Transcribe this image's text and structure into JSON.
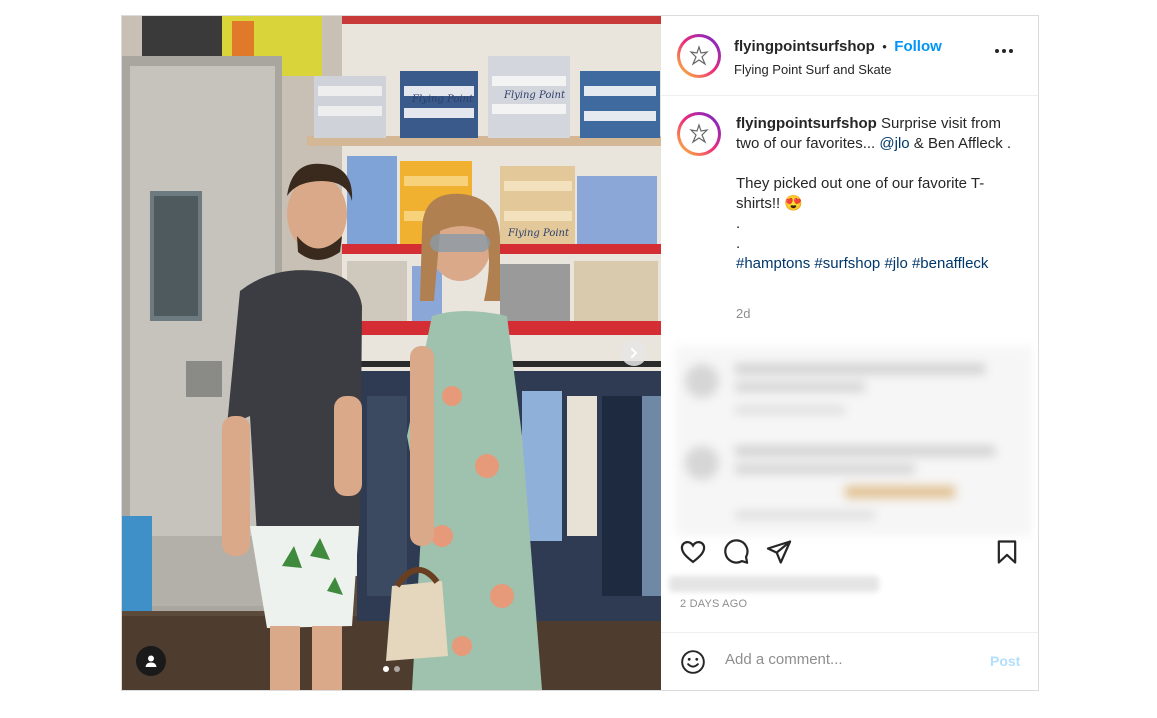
{
  "account": {
    "username": "flyingpointsurfshop",
    "separator": "•",
    "follow_label": "Follow",
    "subtitle": "Flying Point Surf and Skate"
  },
  "caption": {
    "username": "flyingpointsurfshop",
    "text_part1": " Surprise visit from two of our favorites... ",
    "mention": "@jlo",
    "text_part2": " & Ben Affleck .",
    "line2": "They picked out one of our favorite T-shirts!! ",
    "emoji": "😍",
    "dot1": ".",
    "dot2": ".",
    "hashtags": [
      "#hamptons",
      "#surfshop",
      "#jlo",
      "#benaffleck"
    ],
    "time": "2d"
  },
  "media": {
    "photo_count": 2,
    "current_photo": 1,
    "photo_text_lines": [
      "Flying Point",
      "Flying Point",
      "Flying Point"
    ]
  },
  "actions": {
    "like_icon": "heart-icon",
    "comment_icon": "comment-icon",
    "share_icon": "share-icon",
    "save_icon": "bookmark-icon"
  },
  "post_date": "2 DAYS AGO",
  "comment": {
    "placeholder": "Add a comment...",
    "post_label": "Post",
    "emoji_icon": "smiley-icon"
  },
  "colors": {
    "accent": "#0095f6",
    "link": "#00376b",
    "muted": "#8e8e8e",
    "post_disabled": "#b2dffc"
  }
}
